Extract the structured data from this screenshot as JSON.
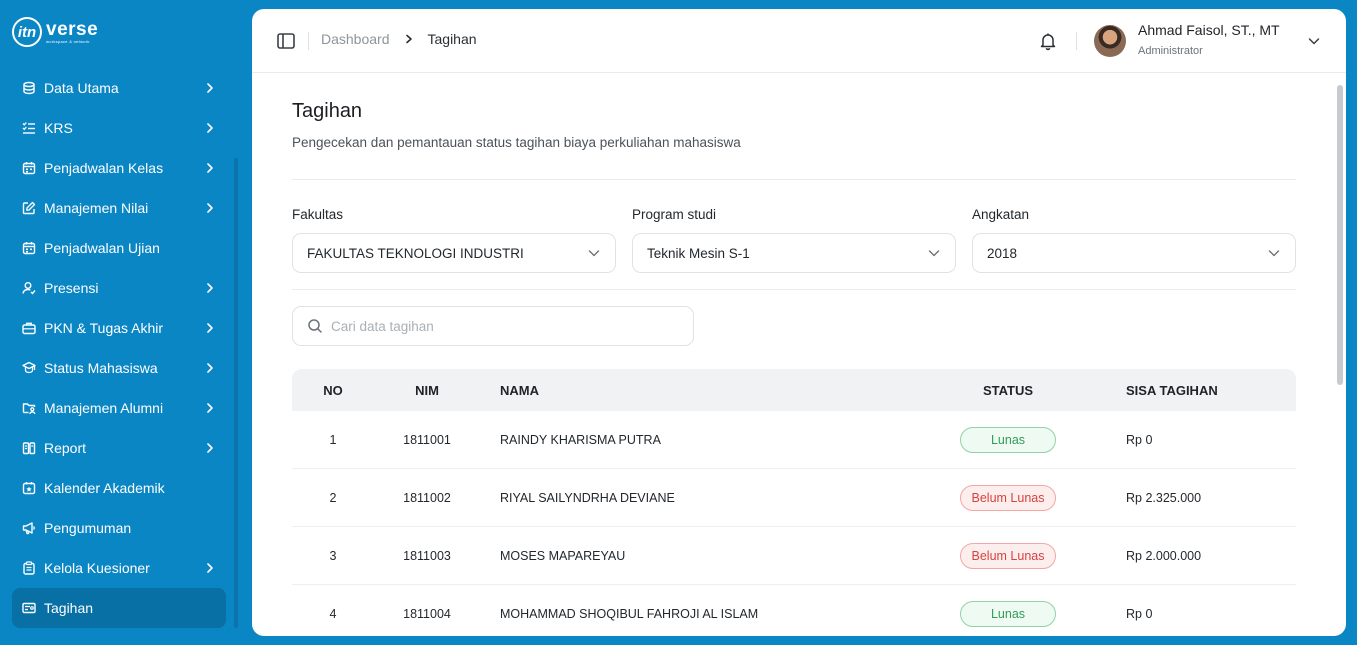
{
  "brand": {
    "logo_mark": "itn",
    "logo_word": "verse",
    "logo_tagline": "workspace & network"
  },
  "sidebar": {
    "items": [
      {
        "label": "Data Utama",
        "icon": "database-icon",
        "has_children": true,
        "active": false
      },
      {
        "label": "KRS",
        "icon": "list-check-icon",
        "has_children": true,
        "active": false
      },
      {
        "label": "Penjadwalan Kelas",
        "icon": "calendar-icon",
        "has_children": true,
        "active": false
      },
      {
        "label": "Manajemen Nilai",
        "icon": "edit-icon",
        "has_children": true,
        "active": false
      },
      {
        "label": "Penjadwalan Ujian",
        "icon": "calendar-icon",
        "has_children": false,
        "active": false
      },
      {
        "label": "Presensi",
        "icon": "user-check-icon",
        "has_children": true,
        "active": false
      },
      {
        "label": "PKN & Tugas Akhir",
        "icon": "briefcase-icon",
        "has_children": true,
        "active": false
      },
      {
        "label": "Status Mahasiswa",
        "icon": "graduation-icon",
        "has_children": true,
        "active": false
      },
      {
        "label": "Manajemen Alumni",
        "icon": "folder-user-icon",
        "has_children": true,
        "active": false
      },
      {
        "label": "Report",
        "icon": "report-icon",
        "has_children": true,
        "active": false
      },
      {
        "label": "Kalender Akademik",
        "icon": "calendar-star-icon",
        "has_children": false,
        "active": false
      },
      {
        "label": "Pengumuman",
        "icon": "megaphone-icon",
        "has_children": false,
        "active": false
      },
      {
        "label": "Kelola Kuesioner",
        "icon": "clipboard-icon",
        "has_children": true,
        "active": false
      },
      {
        "label": "Tagihan",
        "icon": "bill-icon",
        "has_children": false,
        "active": true
      }
    ]
  },
  "header": {
    "breadcrumb": [
      "Dashboard",
      "Tagihan"
    ],
    "user": {
      "name": "Ahmad Faisol, ST., MT",
      "role": "Administrator"
    }
  },
  "page": {
    "title": "Tagihan",
    "subtitle": "Pengecekan dan pemantauan status tagihan biaya perkuliahan mahasiswa"
  },
  "filters": {
    "fakultas": {
      "label": "Fakultas",
      "value": "FAKULTAS TEKNOLOGI INDUSTRI"
    },
    "prodi": {
      "label": "Program studi",
      "value": "Teknik Mesin S-1"
    },
    "angkatan": {
      "label": "Angkatan",
      "value": "2018"
    }
  },
  "search": {
    "placeholder": "Cari data tagihan",
    "value": ""
  },
  "table": {
    "headers": {
      "no": "NO",
      "nim": "NIM",
      "nama": "NAMA",
      "status": "STATUS",
      "sisa": "SISA TAGIHAN"
    },
    "rows": [
      {
        "no": "1",
        "nim": "1811001",
        "nama": "RAINDY KHARISMA PUTRA",
        "status": "Lunas",
        "paid": true,
        "sisa": "Rp 0"
      },
      {
        "no": "2",
        "nim": "1811002",
        "nama": "RIYAL SAILYNDRHA DEVIANE",
        "status": "Belum Lunas",
        "paid": false,
        "sisa": "Rp 2.325.000"
      },
      {
        "no": "3",
        "nim": "1811003",
        "nama": "MOSES MAPAREYAU",
        "status": "Belum Lunas",
        "paid": false,
        "sisa": "Rp 2.000.000"
      },
      {
        "no": "4",
        "nim": "1811004",
        "nama": "MOHAMMAD SHOQIBUL FAHROJI AL ISLAM",
        "status": "Lunas",
        "paid": true,
        "sisa": "Rp 0"
      }
    ]
  },
  "colors": {
    "sidebar": "#0a86c4",
    "active_item": "#0870a5",
    "paid": "#2f9e58",
    "unpaid": "#d6433f"
  }
}
